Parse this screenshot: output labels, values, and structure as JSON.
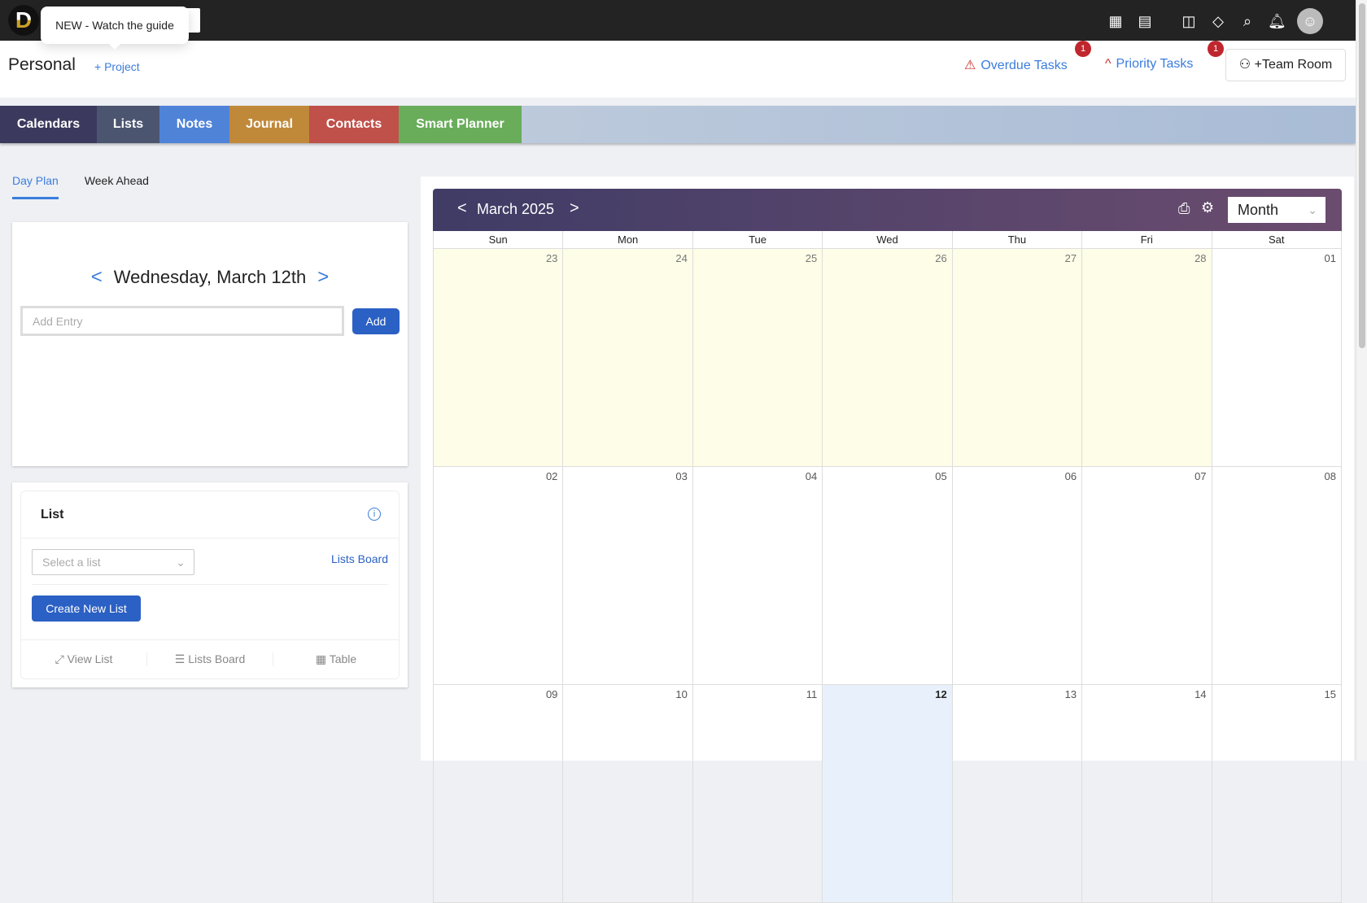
{
  "topbar": {
    "logo": "D",
    "tooltip": "NEW - Watch the guide",
    "icons": [
      "calendar-icon",
      "planner-icon",
      "board-icon",
      "tags-icon",
      "search-icon",
      "bell-icon",
      "user-icon"
    ]
  },
  "header": {
    "title": "Personal",
    "add_project": "+ Project",
    "overdue": "Overdue Tasks",
    "overdue_count": "1",
    "priority": "Priority Tasks",
    "priority_count": "1",
    "team_room": "+Team Room"
  },
  "tabs": [
    {
      "label": "Calendars",
      "color": "#3b3a5e"
    },
    {
      "label": "Lists",
      "color": "#4b5570"
    },
    {
      "label": "Notes",
      "color": "#4f83d8"
    },
    {
      "label": "Journal",
      "color": "#c0893a"
    },
    {
      "label": "Contacts",
      "color": "#c0504a"
    },
    {
      "label": "Smart Planner",
      "color": "#69ad5b"
    }
  ],
  "subtabs": [
    "Day Plan",
    "Week Ahead"
  ],
  "dayplan": {
    "date": "Wednesday, March 12th",
    "entry_placeholder": "Add Entry",
    "add": "Add"
  },
  "list": {
    "title": "List",
    "select_placeholder": "Select a list",
    "lists_board": "Lists Board",
    "create": "Create New List",
    "footer": [
      "View List",
      "Lists Board",
      "Table"
    ]
  },
  "calendar": {
    "month": "March 2025",
    "view": "Month",
    "weekdays": [
      "Sun",
      "Mon",
      "Tue",
      "Wed",
      "Thu",
      "Fri",
      "Sat"
    ],
    "weeks": [
      [
        "23",
        "24",
        "25",
        "26",
        "27",
        "28",
        "01"
      ],
      [
        "02",
        "03",
        "04",
        "05",
        "06",
        "07",
        "08"
      ],
      [
        "09",
        "10",
        "11",
        "12",
        "13",
        "14",
        "15"
      ]
    ],
    "today": "12"
  }
}
